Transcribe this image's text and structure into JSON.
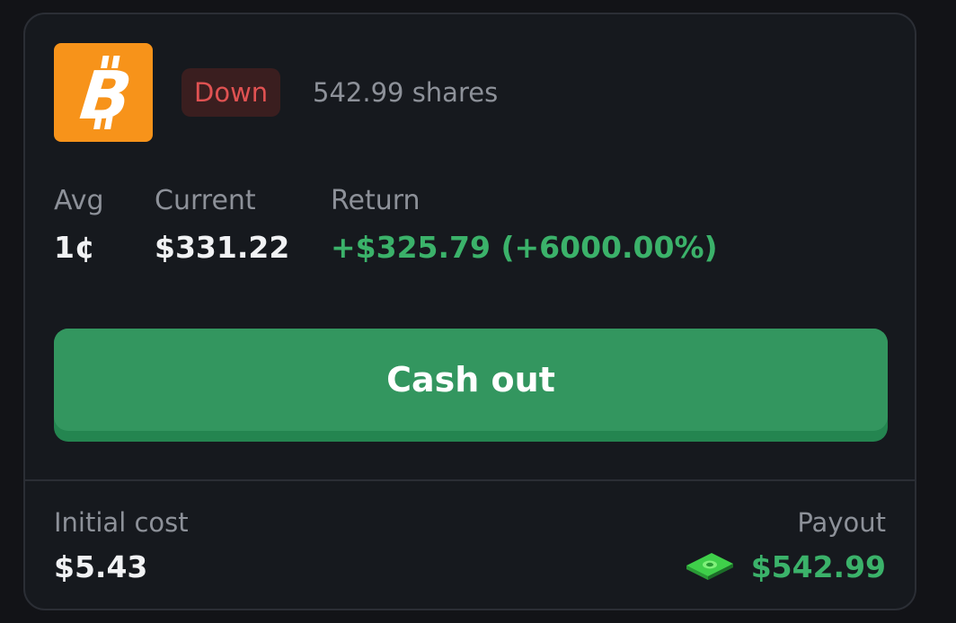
{
  "position": {
    "asset_icon": "bitcoin-icon",
    "direction": "Down",
    "shares": "542.99 shares"
  },
  "stats": {
    "avg_label": "Avg",
    "avg_value": "1¢",
    "current_label": "Current",
    "current_value": "$331.22",
    "return_label": "Return",
    "return_value": "+$325.79 (+6000.00%)"
  },
  "actions": {
    "cash_out_label": "Cash out"
  },
  "footer": {
    "initial_cost_label": "Initial cost",
    "initial_cost_value": "$5.43",
    "payout_label": "Payout",
    "payout_icon": "cash-money-icon",
    "payout_value": "$542.99"
  },
  "colors": {
    "background": "#121317",
    "card": "#16191e",
    "bitcoin_orange": "#f7931a",
    "down_red": "#e05252",
    "positive_green": "#3bb26a",
    "button_green": "#33965f"
  }
}
